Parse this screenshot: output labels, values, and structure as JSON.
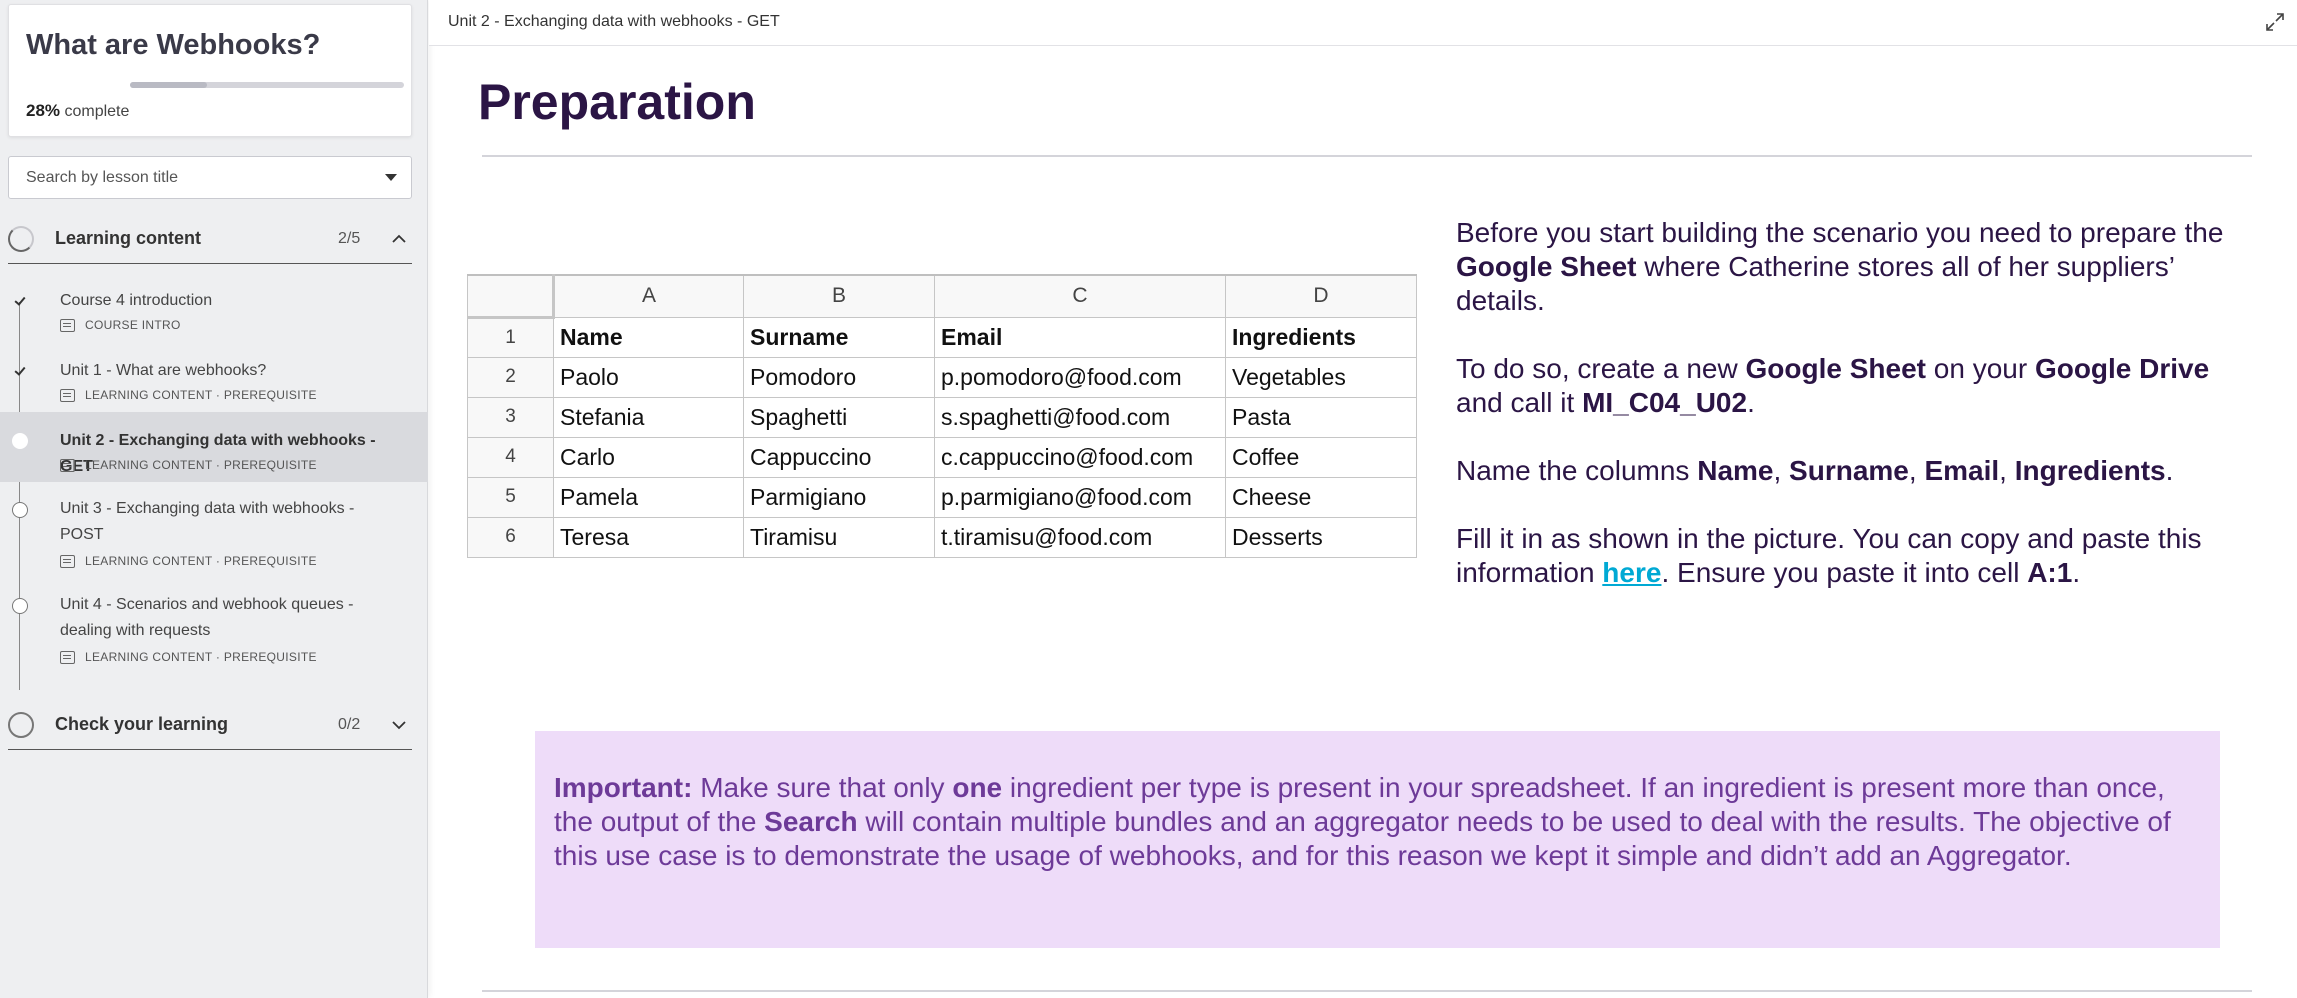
{
  "sidebar": {
    "course_title": "What are Webhooks?",
    "progress_percent": "28%",
    "progress_fraction": 0.28,
    "progress_suffix": " complete",
    "search_placeholder": "Search by lesson title",
    "sections": [
      {
        "label": "Learning content",
        "count": "2/5",
        "expanded": true
      },
      {
        "label": "Check your learning",
        "count": "0/2",
        "expanded": false
      }
    ],
    "lessons": [
      {
        "title": "Course 4 introduction",
        "meta": "COURSE INTRO",
        "status": "done"
      },
      {
        "title": "Unit 1 - What are webhooks?",
        "meta": "LEARNING CONTENT · PREREQUISITE",
        "status": "done"
      },
      {
        "title": "Unit 2 - Exchanging data with webhooks - GET",
        "meta": "LEARNING CONTENT · PREREQUISITE",
        "status": "current"
      },
      {
        "title": "Unit 3 - Exchanging data with webhooks - POST",
        "meta": "LEARNING CONTENT · PREREQUISITE",
        "status": "open"
      },
      {
        "title": "Unit 4 - Scenarios and webhook queues - dealing with requests",
        "meta": "LEARNING CONTENT · PREREQUISITE",
        "status": "open"
      }
    ]
  },
  "topbar": {
    "title": "Unit 2 - Exchanging data with webhooks - GET"
  },
  "main": {
    "heading": "Preparation",
    "sheet": {
      "col_letters": [
        "A",
        "B",
        "C",
        "D"
      ],
      "rows": [
        {
          "n": "1",
          "cells": [
            "Name",
            "Surname",
            "Email",
            "Ingredients"
          ]
        },
        {
          "n": "2",
          "cells": [
            "Paolo",
            "Pomodoro",
            "p.pomodoro@food.com",
            "Vegetables"
          ]
        },
        {
          "n": "3",
          "cells": [
            "Stefania",
            "Spaghetti",
            "s.spaghetti@food.com",
            "Pasta"
          ]
        },
        {
          "n": "4",
          "cells": [
            "Carlo",
            "Cappuccino",
            "c.cappuccino@food.com",
            "Coffee"
          ]
        },
        {
          "n": "5",
          "cells": [
            "Pamela",
            "Parmigiano",
            "p.parmigiano@food.com",
            "Cheese"
          ]
        },
        {
          "n": "6",
          "cells": [
            "Teresa",
            "Tiramisu",
            "t.tiramisu@food.com",
            "Desserts"
          ]
        }
      ]
    },
    "para1": {
      "t1": "Before you start building the scenario you need to prepare the ",
      "b1": "Google Sheet",
      "t2": " where Catherine stores all of her suppliers’ details."
    },
    "para2": {
      "t1": "To do so, create a new ",
      "b1": "Google Sheet",
      "t2": " on your ",
      "b2": "Google Drive",
      "t3": " and call it ",
      "b3": "MI_C04_U02",
      "t4": "."
    },
    "para3": {
      "t1": "Name the columns ",
      "b1": "Name",
      "s1": ", ",
      "b2": "Surname",
      "s2": ", ",
      "b3": "Email",
      "s3": ", ",
      "b4": "Ingredients",
      "t2": "."
    },
    "para4": {
      "t1": "Fill it in as shown in the picture. You can copy and paste this information ",
      "link": "here",
      "t2": ". Ensure you paste it into cell ",
      "b1": "A:1",
      "t3": "."
    },
    "callout": {
      "lead": "Important:",
      "t1": " Make sure that only ",
      "b1": "one",
      "t2": " ingredient per type is present in your spreadsheet. If an ingredient is present more than once, the output of the ",
      "b2": "Search",
      "t3": " will contain multiple bundles and an aggregator needs to be used to deal with the results. The objective of this use case is to demonstrate the usage of webhooks, and for this reason we kept it simple and didn’t add an Aggregator."
    }
  }
}
